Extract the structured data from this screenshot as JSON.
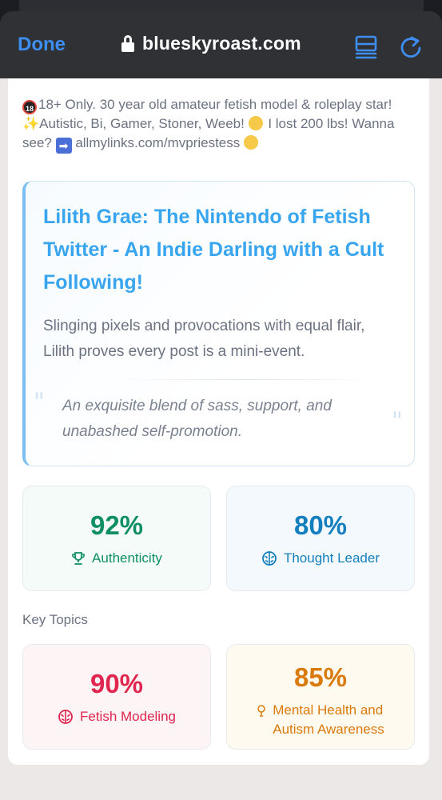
{
  "browser": {
    "done_label": "Done",
    "url": "blueskyroast.com"
  },
  "profile": {
    "bio_part1": "18+ Only. 30 year old amateur fetish model & roleplay star! ",
    "bio_part2": "Autistic, Bi, Gamer, Stoner, Weeb! ",
    "bio_part3": " I lost 200 lbs! Wanna see? ",
    "bio_link": "allmylinks.com/mvpriestess"
  },
  "roast": {
    "title": "Lilith Grae: The Nintendo of Fetish Twitter - An Indie Darling with a Cult Following!",
    "subtitle": "Slinging pixels and provocations with equal flair, Lilith proves every post is a mini-event.",
    "quote": "An exquisite blend of sass, support, and unabashed self-promotion."
  },
  "stats": [
    {
      "value": "92%",
      "label": "Authenticity",
      "icon": "trophy-icon",
      "color": "#0f8f63"
    },
    {
      "value": "80%",
      "label": "Thought Leader",
      "icon": "brain-icon",
      "color": "#137fbe"
    }
  ],
  "key_topics": {
    "heading": "Key Topics",
    "items": [
      {
        "value": "90%",
        "label": "Fetish Modeling",
        "icon": "brain-icon",
        "color": "#e0264f"
      },
      {
        "value": "85%",
        "label": "Mental Health and Autism Awareness",
        "icon": "lightbulb-icon",
        "color": "#d97a0b"
      }
    ]
  }
}
